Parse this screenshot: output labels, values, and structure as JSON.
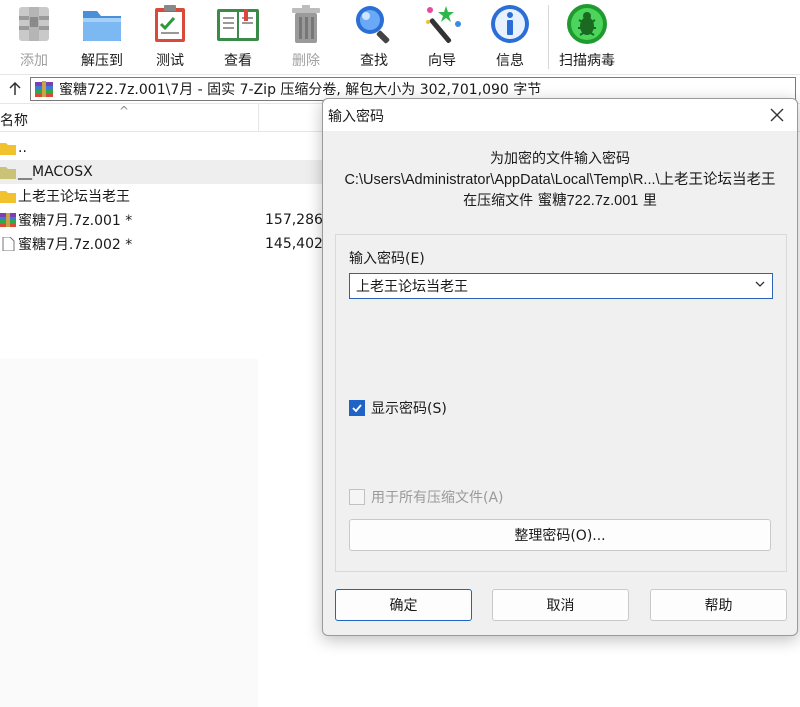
{
  "toolbar": {
    "add": "添加",
    "extract": "解压到",
    "test": "测试",
    "view": "查看",
    "delete": "删除",
    "find": "查找",
    "wizard": "向导",
    "info": "信息",
    "virus_scan": "扫描病毒"
  },
  "path": {
    "text": "蜜糖722.7z.001\\7月 - 固实 7-Zip 压缩分卷, 解包大小为 302,701,090 字节"
  },
  "list": {
    "header_name": "名称",
    "rows": [
      {
        "name": "..",
        "size": ""
      },
      {
        "name": "__MACOSX",
        "size": ""
      },
      {
        "name": "上老王论坛当老王",
        "size": ""
      },
      {
        "name": "蜜糖7月.7z.001 *",
        "size": "157,286"
      },
      {
        "name": "蜜糖7月.7z.002 *",
        "size": "145,402"
      }
    ]
  },
  "dialog": {
    "title": "输入密码",
    "info_line1": "为加密的文件输入密码",
    "info_line2": "C:\\Users\\Administrator\\AppData\\Local\\Temp\\R...\\上老王论坛当老王",
    "info_line3_prefix": "在压缩文件 ",
    "info_line3_file": "蜜糖722.7z.001",
    "info_line3_suffix": " 里",
    "password_label": "输入密码(E)",
    "password_value": "上老王论坛当老王",
    "show_password": "显示密码(S)",
    "use_for_all": "用于所有压缩文件(A)",
    "organize": "整理密码(O)...",
    "ok": "确定",
    "cancel": "取消",
    "help": "帮助"
  }
}
